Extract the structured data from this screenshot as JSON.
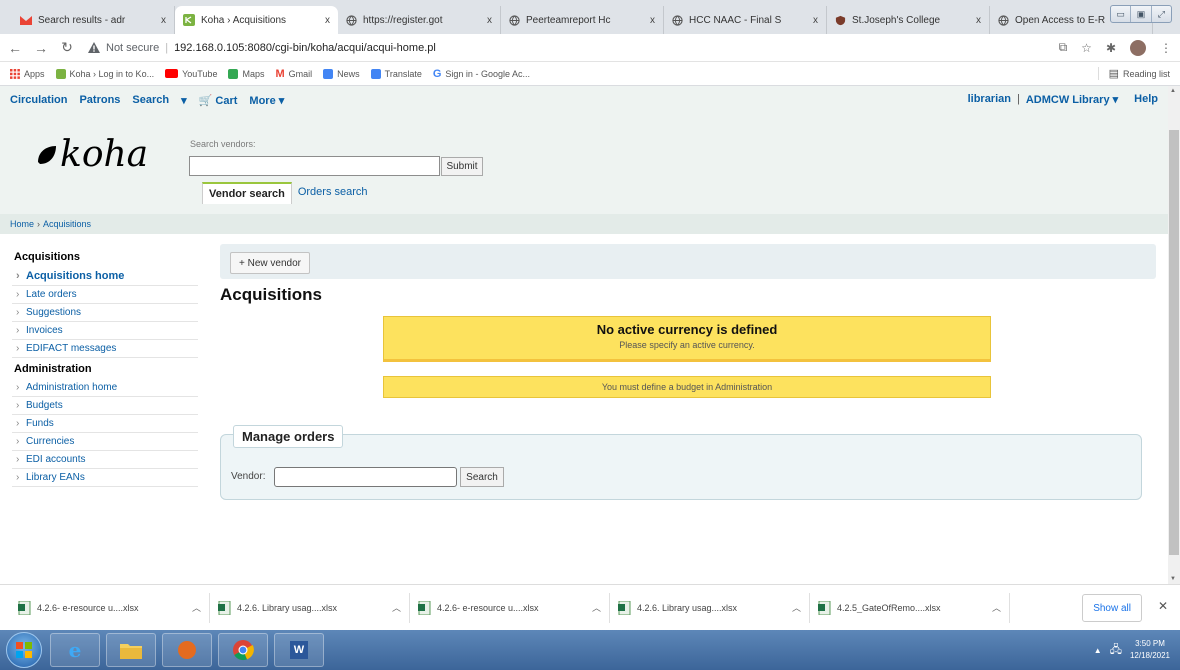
{
  "browser": {
    "tabs": [
      {
        "label": "Search results - adr",
        "active": false
      },
      {
        "label": "Koha › Acquisitions",
        "active": true
      },
      {
        "label": "https://register.got",
        "active": false
      },
      {
        "label": "Peerteamreport Hc",
        "active": false
      },
      {
        "label": "HCC NAAC - Final S",
        "active": false
      },
      {
        "label": "St.Joseph's College",
        "active": false
      },
      {
        "label": "Open Access to E-R",
        "active": false
      }
    ],
    "tab_close": "x",
    "new_tab": "+",
    "warning_label": "Not secure",
    "url": "192.168.0.105:8080/cgi-bin/koha/acqui/acqui-home.pl",
    "bookmarks": [
      {
        "label": "Apps",
        "color": "#ea4335"
      },
      {
        "label": "Koha › Log in to Ko...",
        "color": "#7cb342"
      },
      {
        "label": "YouTube",
        "color": "#ff0000"
      },
      {
        "label": "Maps",
        "color": "#34a853"
      },
      {
        "label": "Gmail",
        "color": "#ea4335"
      },
      {
        "label": "News",
        "color": "#4285f4"
      },
      {
        "label": "Translate",
        "color": "#4285f4"
      },
      {
        "label": "Sign in - Google Ac...",
        "color": "#4285f4"
      }
    ],
    "reading_list": "Reading list"
  },
  "koha": {
    "topnav": [
      "Circulation",
      "Patrons",
      "Search",
      "▾",
      "🛒 Cart",
      "More ▾"
    ],
    "user": "librarian",
    "library": "ADMCW Library ▾",
    "help": "Help",
    "logo_text": "koha",
    "search_label": "Search vendors:",
    "search_value": "",
    "submit_label": "Submit",
    "search_tabs": [
      {
        "label": "Vendor search",
        "active": true
      },
      {
        "label": "Orders search",
        "active": false
      }
    ],
    "breadcrumb": [
      "Home",
      "Acquisitions"
    ],
    "sidebar": {
      "acq_heading": "Acquisitions",
      "acq_items": [
        "Acquisitions home",
        "Late orders",
        "Suggestions",
        "Invoices",
        "EDIFACT messages"
      ],
      "admin_heading": "Administration",
      "admin_items": [
        "Administration home",
        "Budgets",
        "Funds",
        "Currencies",
        "EDI accounts",
        "Library EANs"
      ]
    },
    "new_vendor_label": "+ New vendor",
    "page_title": "Acquisitions",
    "alert_currency_title": "No active currency is defined",
    "alert_currency_sub": "Please specify an active currency.",
    "alert_budget": "You must define a budget in Administration",
    "manage_orders_title": "Manage orders",
    "vendor_label": "Vendor:",
    "vendor_value": "",
    "search_button": "Search"
  },
  "downloads": {
    "items": [
      "4.2.6- e-resource u....xlsx",
      "4.2.6. Library usag....xlsx",
      "4.2.6- e-resource u....xlsx",
      "4.2.6. Library usag....xlsx",
      "4.2.5_GateOfRemo....xlsx"
    ],
    "show_all": "Show all",
    "close": "✕"
  },
  "taskbar": {
    "time": "3:50 PM",
    "date": "12/18/2021"
  },
  "colors": {
    "koha_link": "#0b5fa5",
    "alert_yellow": "#fde25e",
    "koha_header_bg": "#eef3f1"
  }
}
